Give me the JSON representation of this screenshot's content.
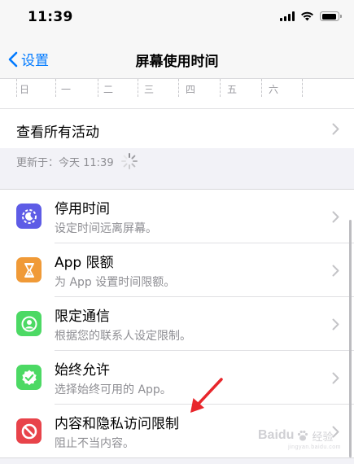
{
  "status_bar": {
    "time": "11:39"
  },
  "nav": {
    "back_label": "设置",
    "title": "屏幕使用时间"
  },
  "week_days": [
    "日",
    "一",
    "二",
    "三",
    "四",
    "五",
    "六"
  ],
  "activity": {
    "label": "查看所有活动"
  },
  "update": {
    "text": "更新于：今天 11:39"
  },
  "menu": [
    {
      "title": "停用时间",
      "subtitle": "设定时间远离屏幕。",
      "icon": "moon-clock-icon",
      "color": "#5e5ce6"
    },
    {
      "title": "App 限额",
      "subtitle": "为 App 设置时间限额。",
      "icon": "hourglass-icon",
      "color": "#f09a37"
    },
    {
      "title": "限定通信",
      "subtitle": "根据您的联系人设定限制。",
      "icon": "person-circle-icon",
      "color": "#4cd964"
    },
    {
      "title": "始终允许",
      "subtitle": "选择始终可用的 App。",
      "icon": "checkmark-seal-icon",
      "color": "#4cd964"
    },
    {
      "title": "内容和隐私访问限制",
      "subtitle": "阻止不当内容。",
      "icon": "prohibited-icon",
      "color": "#e8434a"
    }
  ],
  "watermark": {
    "brand": "Baidu",
    "cn": "经验",
    "sub": "jingyan.baidu.com"
  }
}
